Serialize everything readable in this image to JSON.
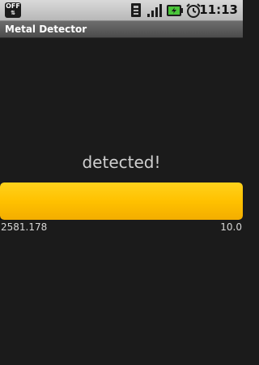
{
  "status_bar": {
    "off_label": "OFF",
    "off_arrows": "⇅",
    "time": "11:13",
    "icons": [
      "off-icon",
      "sim-icon",
      "signal-icon",
      "battery-icon",
      "alarm-icon"
    ],
    "battery_color": "#4ac53a"
  },
  "app": {
    "title": "Metal Detector"
  },
  "detector": {
    "status": "detected!",
    "reading": "2581.178",
    "max": "10.0",
    "level": 1.0,
    "bar_color": "#ffc100"
  }
}
